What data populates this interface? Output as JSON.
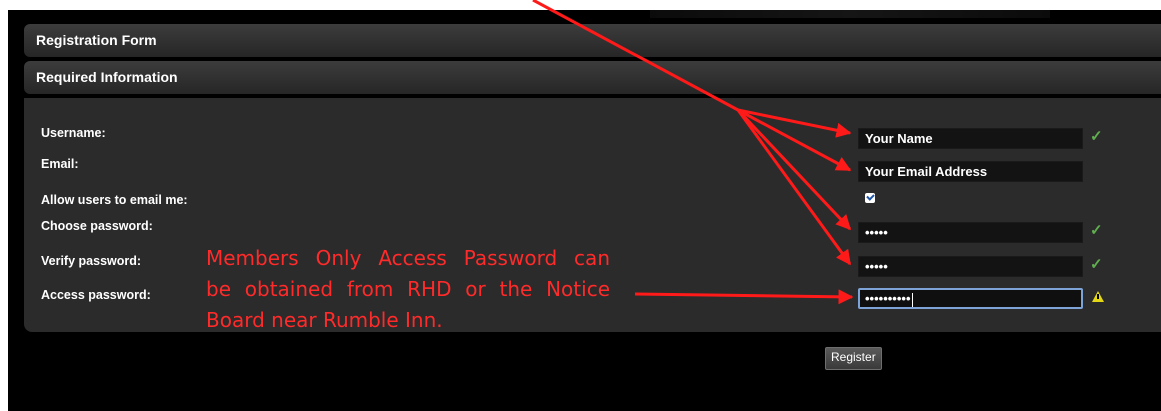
{
  "form": {
    "title": "Registration Form",
    "section": "Required Information"
  },
  "fields": {
    "username": {
      "label": "Username:",
      "value": "Your Name"
    },
    "email": {
      "label": "Email:",
      "value": "Your Email Address"
    },
    "allow_email": {
      "label": "Allow users to email me:",
      "checked": true
    },
    "choose_password": {
      "label": "Choose password:",
      "value": "•••••"
    },
    "verify_password": {
      "label": "Verify password:",
      "value": "•••••"
    },
    "access_password": {
      "label": "Access password:",
      "value": "••••••••••"
    }
  },
  "annotation": {
    "line1": "Members Only Access Password can",
    "line2": "be obtained from RHD or the Notice",
    "line3": "Board near Rumble Inn."
  },
  "icons": {
    "valid": "✓",
    "warning": "warning-triangle"
  },
  "colors": {
    "annotation": "#ff2a2a",
    "valid": "#5faf4e",
    "warning": "#e4d814",
    "focus": "#7ea3d6"
  },
  "register_label": "Register"
}
